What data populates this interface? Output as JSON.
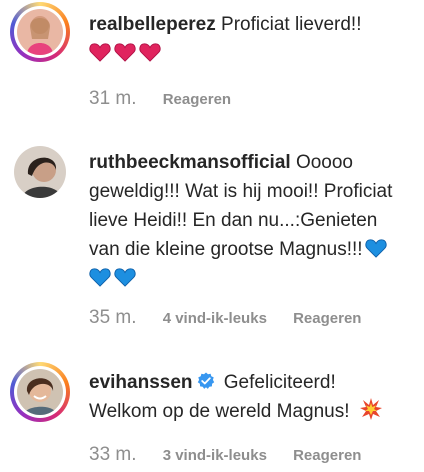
{
  "comments": [
    {
      "username": "realbelleperez",
      "text": "Proficiat lieverd!!",
      "emojis": [
        "red-heart",
        "red-heart",
        "red-heart"
      ],
      "time": "31 m.",
      "reply_label": "Reageren"
    },
    {
      "username": "ruthbeeckmansofficial",
      "text": "Ooooo geweldig!!! Wat is hij mooi!! Proficiat lieve Heidi!! En dan nu...:Genieten van die kleine grootse Magnus!!!",
      "emojis": [
        "blue-heart",
        "blue-heart",
        "blue-heart"
      ],
      "time": "35 m.",
      "likes": "4 vind-ik-leuks",
      "reply_label": "Reageren"
    },
    {
      "username": "evihanssen",
      "verified": true,
      "text": "Gefeliciteerd! Welkom op de wereld Magnus!",
      "emojis": [
        "collision"
      ],
      "time": "33 m.",
      "likes": "3 vind-ik-leuks",
      "reply_label": "Reageren"
    }
  ],
  "colors": {
    "text": "#262626",
    "secondary": "#8e8e8e",
    "red_heart": "#e0245e",
    "blue_heart": "#1d8fe0",
    "verified": "#3897f0"
  }
}
